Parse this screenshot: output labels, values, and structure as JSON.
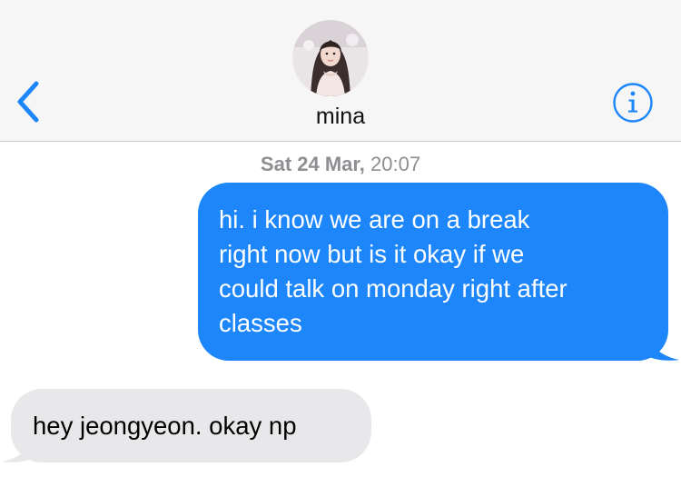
{
  "header": {
    "contact_name": "mina",
    "avatar_label": "contact photo",
    "back_icon": "chevron-left-icon",
    "info_icon": "info-icon",
    "accent_color": "#1c86fa"
  },
  "conversation": {
    "timestamp_day": "Sat 24 Mar,",
    "timestamp_time": "20:07",
    "messages": [
      {
        "direction": "sent",
        "text": "hi. i know we are on a break\nright now but is it okay if we\ncould talk on monday right after\nclasses",
        "color": "#1c86fa"
      },
      {
        "direction": "received",
        "text": "hey jeongyeon. okay np",
        "color": "#e8e8ea"
      }
    ]
  }
}
